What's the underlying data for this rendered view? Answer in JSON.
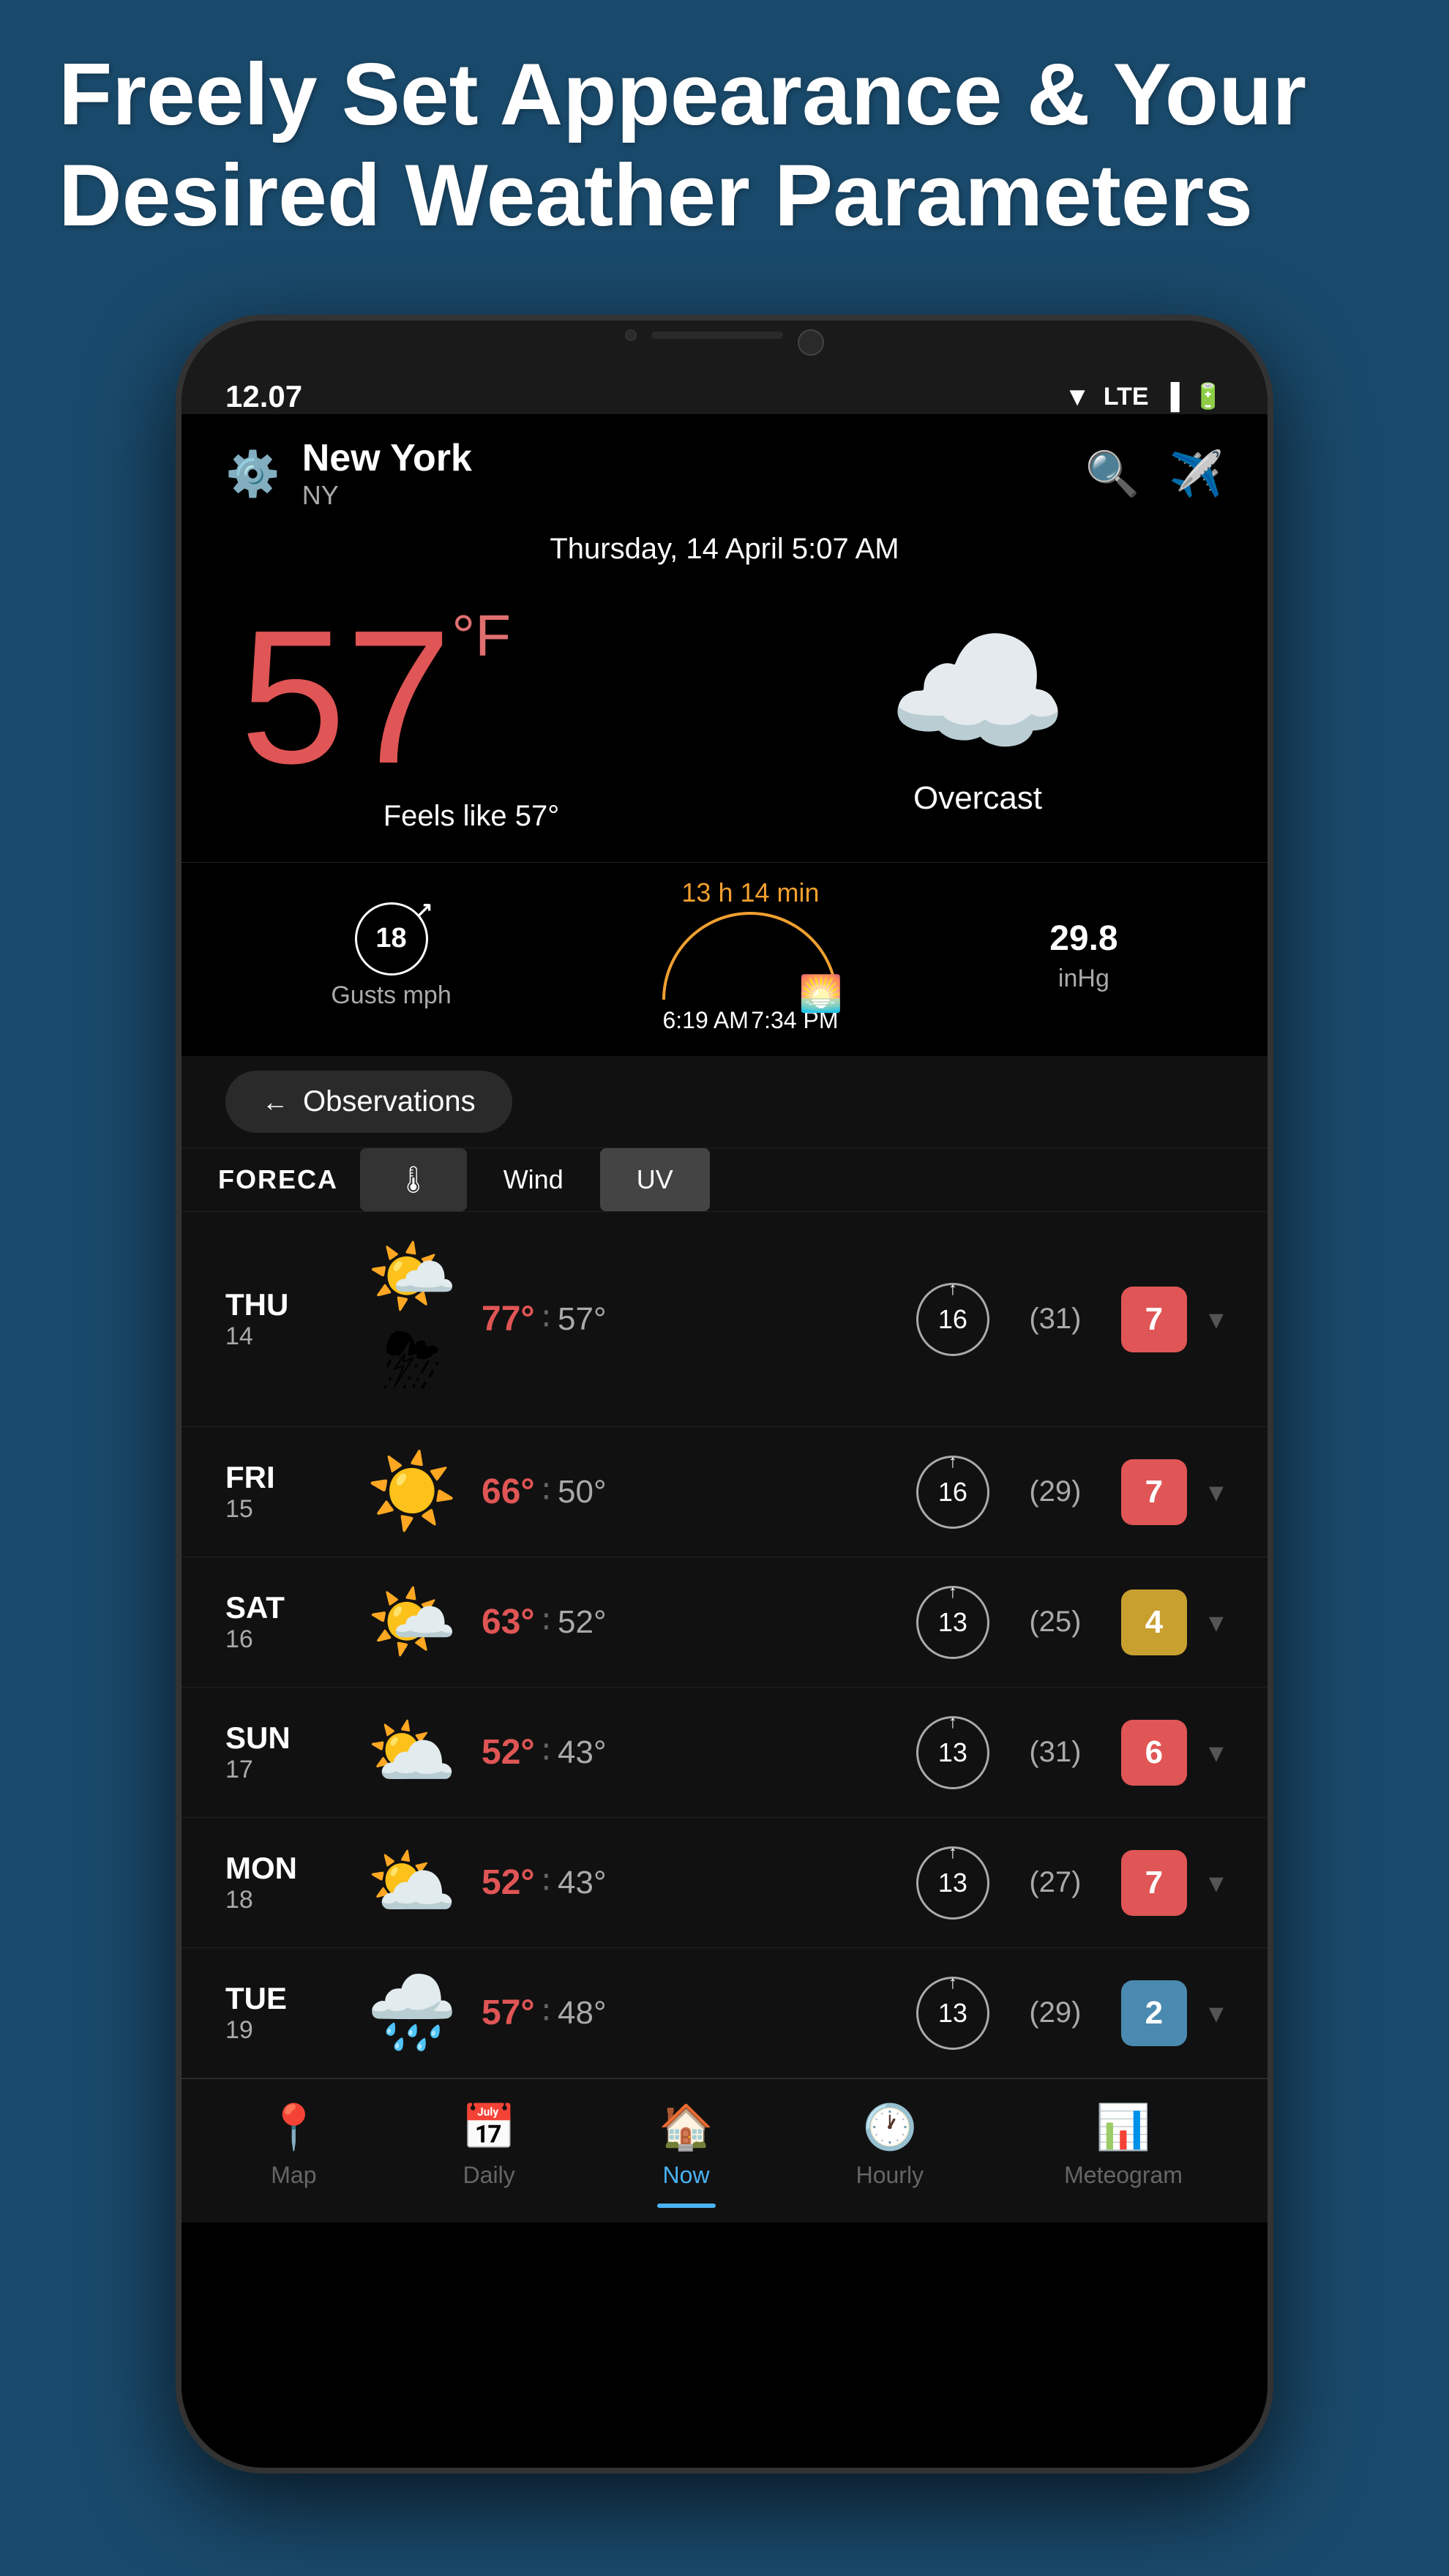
{
  "header": {
    "line1": "Freely Set Appearance & Your",
    "line2": "Desired Weather Parameters"
  },
  "status_bar": {
    "time": "12.07",
    "network": "LTE"
  },
  "app_header": {
    "city": "New York",
    "state": "NY",
    "date": "Thursday, 14 April 5:07 AM"
  },
  "current_weather": {
    "temp": "57",
    "unit": "°F",
    "feels_like": "Feels like 57°",
    "description": "Overcast",
    "gusts": "18",
    "gusts_label": "Gusts mph",
    "sun_duration": "13 h 14 min",
    "sunrise": "6:19 AM",
    "sunset": "7:34 PM",
    "pressure": "29.8",
    "pressure_unit": "inHg"
  },
  "observations_button": "Observations",
  "tabs": {
    "logo": "FORECA",
    "thermo": "🌡",
    "wind": "Wind",
    "uv": "UV"
  },
  "forecast": [
    {
      "day": "THU",
      "num": "14",
      "icon": "⛈️☀️",
      "emoji": "🌤️⛈",
      "hi": "77°",
      "lo": "57°",
      "wind": "16",
      "wind_dir": "↑",
      "wind_extra": "(31)",
      "uv": "7",
      "uv_class": "uv-high"
    },
    {
      "day": "FRI",
      "num": "15",
      "emoji": "☀️",
      "hi": "66°",
      "lo": "50°",
      "wind": "16",
      "wind_dir": "↑",
      "wind_extra": "(29)",
      "uv": "7",
      "uv_class": "uv-high"
    },
    {
      "day": "SAT",
      "num": "16",
      "emoji": "🌤️",
      "hi": "63°",
      "lo": "52°",
      "wind": "13",
      "wind_dir": "↑",
      "wind_extra": "(25)",
      "uv": "4",
      "uv_class": "uv-medium"
    },
    {
      "day": "SUN",
      "num": "17",
      "emoji": "⛅",
      "hi": "52°",
      "lo": "43°",
      "wind": "13",
      "wind_dir": "↑",
      "wind_extra": "(31)",
      "uv": "6",
      "uv_class": "uv-high"
    },
    {
      "day": "MON",
      "num": "18",
      "emoji": "⛅",
      "hi": "52°",
      "lo": "43°",
      "wind": "13",
      "wind_dir": "↑",
      "wind_extra": "(27)",
      "uv": "7",
      "uv_class": "uv-high"
    },
    {
      "day": "TUE",
      "num": "19",
      "emoji": "🌧️",
      "hi": "57°",
      "lo": "48°",
      "wind": "13",
      "wind_dir": "↑",
      "wind_extra": "(29)",
      "uv": "2",
      "uv_class": "uv-low"
    }
  ],
  "nav": {
    "items": [
      {
        "icon": "📍",
        "label": "Map",
        "active": false
      },
      {
        "icon": "📅",
        "label": "Daily",
        "active": false
      },
      {
        "icon": "🏠",
        "label": "Now",
        "active": true
      },
      {
        "icon": "🕐",
        "label": "Hourly",
        "active": false
      },
      {
        "icon": "📊",
        "label": "Meteogram",
        "active": false
      }
    ]
  }
}
